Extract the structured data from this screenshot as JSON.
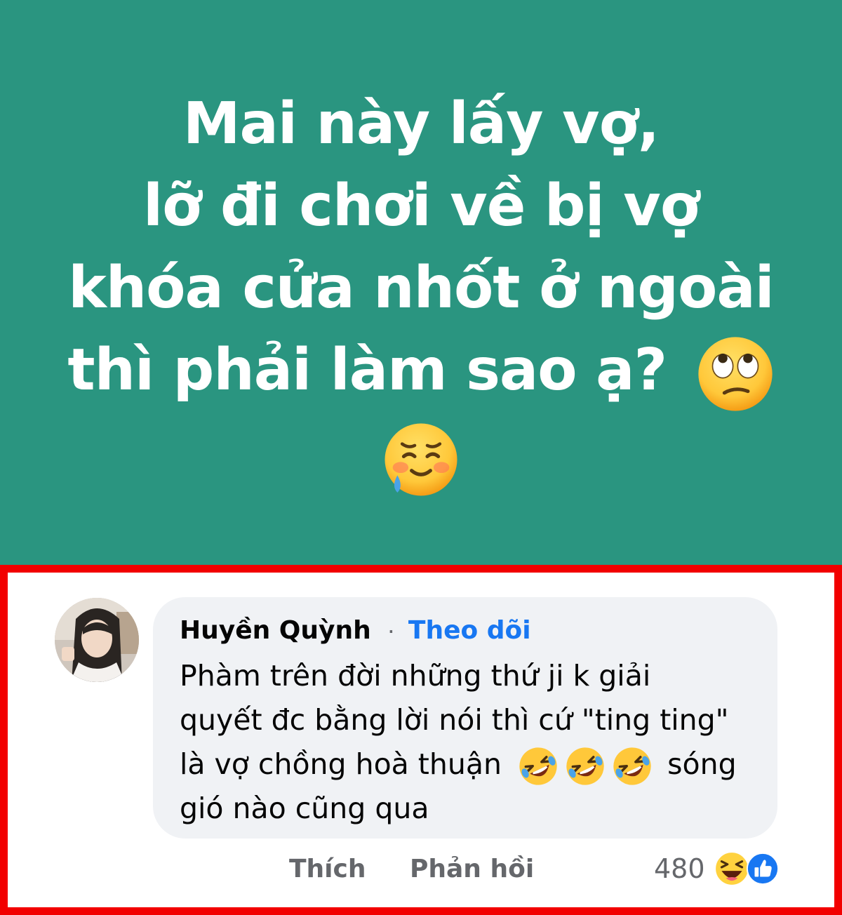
{
  "post": {
    "background_color": "#2a9580",
    "lines": [
      "Mai này lấy vợ,",
      "lỡ đi chơi về bị vợ",
      "khóa cửa nhốt ở ngoài",
      "thì phải làm sao ạ?"
    ],
    "emojis": [
      "eye-roll-emoji",
      "smiling-face-with-tear-emoji"
    ]
  },
  "comment": {
    "author": "Huyền Quỳnh",
    "separator": "·",
    "follow_label": "Theo dõi",
    "body_lines": [
      "Phàm trên đời những thứ ji k giải",
      "quyết đc bằng lời nói thì cứ \"ting ting\"",
      "là vợ chồng hoà thuận",
      "sóng",
      "gió nào cũng qua"
    ],
    "inline_emojis": [
      "rolling-on-floor-laughing-emoji",
      "rolling-on-floor-laughing-emoji",
      "rolling-on-floor-laughing-emoji"
    ],
    "like_label": "Thích",
    "reply_label": "Phản hồi",
    "reaction_count": "480",
    "reaction_icons": [
      "haha-reaction-icon",
      "like-reaction-icon"
    ]
  },
  "colors": {
    "highlight_border": "#f20000",
    "link_blue": "#1877f2",
    "bubble_bg": "#f0f2f5",
    "muted_text": "#65676b"
  }
}
